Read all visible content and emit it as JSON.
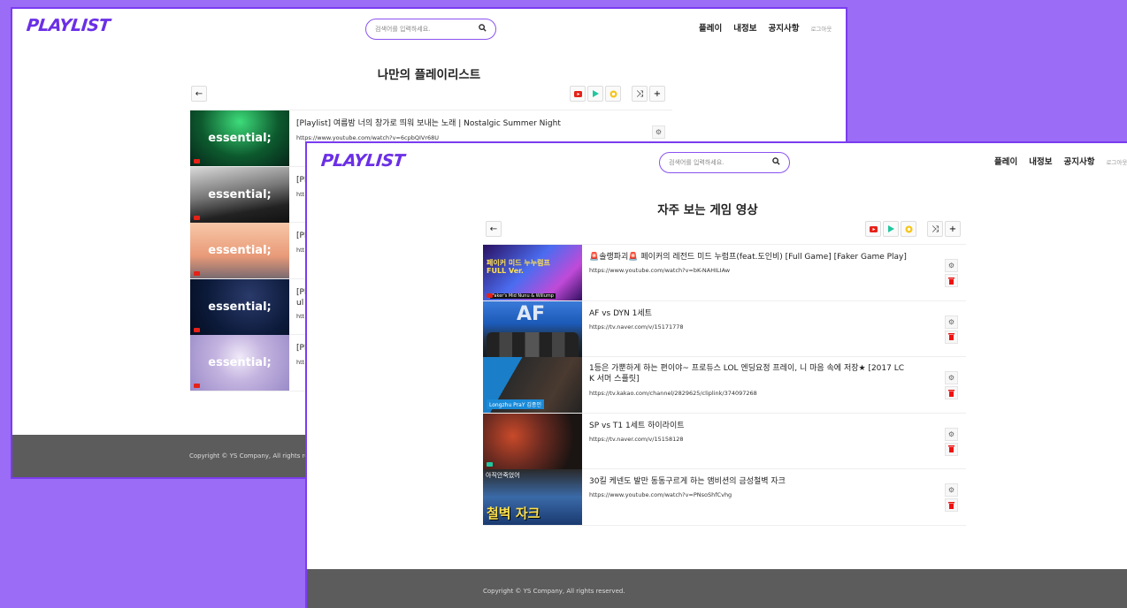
{
  "colors": {
    "background": "#9b6cf5",
    "accent": "#6b2fe6",
    "footer": "#5c5c5c",
    "delete": "#e11111",
    "play_red": "#e62117",
    "play_green": "#1fc7a0",
    "play_yellow": "#f5c518"
  },
  "back": {
    "logo": "PLAYLIST",
    "search_placeholder": "검색어를 입력하세요.",
    "nav": {
      "play": "플레이",
      "myinfo": "내정보",
      "notice": "공지사항",
      "logout": "로그아웃"
    },
    "page_title": "나만의 플레이리스트",
    "items": [
      {
        "title": "[Playlist] 여름밤 너의 창가로 띄워 보내는 노래 | Nostalgic Summer Night",
        "url": "https://www.youtube.com/watch?v=6cpbQIVr68U",
        "thumb_text": "essential;"
      },
      {
        "title": "[Pl",
        "url": "htt",
        "thumb_text": "essential;"
      },
      {
        "title": "[Pl",
        "url": "htt",
        "thumb_text": "essential;"
      },
      {
        "title": "[Pl",
        "title2": "ul",
        "url": "htt",
        "thumb_text": "essential;"
      },
      {
        "title": "[Pl",
        "url": "htt",
        "thumb_text": "essential;"
      }
    ],
    "footer": "Copyright © YS Company, All rights re"
  },
  "front": {
    "logo": "PLAYLIST",
    "search_placeholder": "검색어를 입력하세요.",
    "nav": {
      "play": "플레이",
      "myinfo": "내정보",
      "notice": "공지사항",
      "logout": "로그아웃"
    },
    "page_title": "자주 보는 게임 영상",
    "items": [
      {
        "title": "🚨솔랭파괴🚨 페이커의 레전드 미드 누럼프(feat.도인비) [Full Game] [Faker Game Play]",
        "url": "https://www.youtube.com/watch?v=bK-NAHILIAw",
        "thumb_text": "페이커 미드 누누럼프 FULL Ver.",
        "thumb_caption": "Faker's Mid Nunu & Willump"
      },
      {
        "title": "AF vs DYN 1세트",
        "url": "https://tv.naver.com/v/15171778",
        "thumb_text": "AF"
      },
      {
        "title": "1등은 가뿐하게 하는 편이야~ 프로듀스 LOL 엔딩요정 프레이, 니 마음 속에 저장★ [2017 LC",
        "title2": "K 서머 스플릿]",
        "url": "https://tv.kakao.com/channel/2829625/cliplink/374097268",
        "thumb_text": "Longzhu PraY 김종인",
        "thumb_caption": ""
      },
      {
        "title": "SP vs T1 1세트 하이라이트",
        "url": "https://tv.naver.com/v/15158128",
        "thumb_text": ""
      },
      {
        "title": "30킬 케넨도 발만 동동구르게 하는 앰비션의 금성철벽 자크",
        "url": "https://www.youtube.com/watch?v=PNsoShfCvhg",
        "thumb_text": "철벽 자크",
        "thumb_caption": "아직안죽었어"
      }
    ],
    "footer": "Copyright © YS Company, All rights reserved."
  },
  "icons": {
    "back": "←",
    "search": "magnifier",
    "shuffle": "⤨",
    "add": "+",
    "settings": "⚙",
    "delete": "trash"
  }
}
